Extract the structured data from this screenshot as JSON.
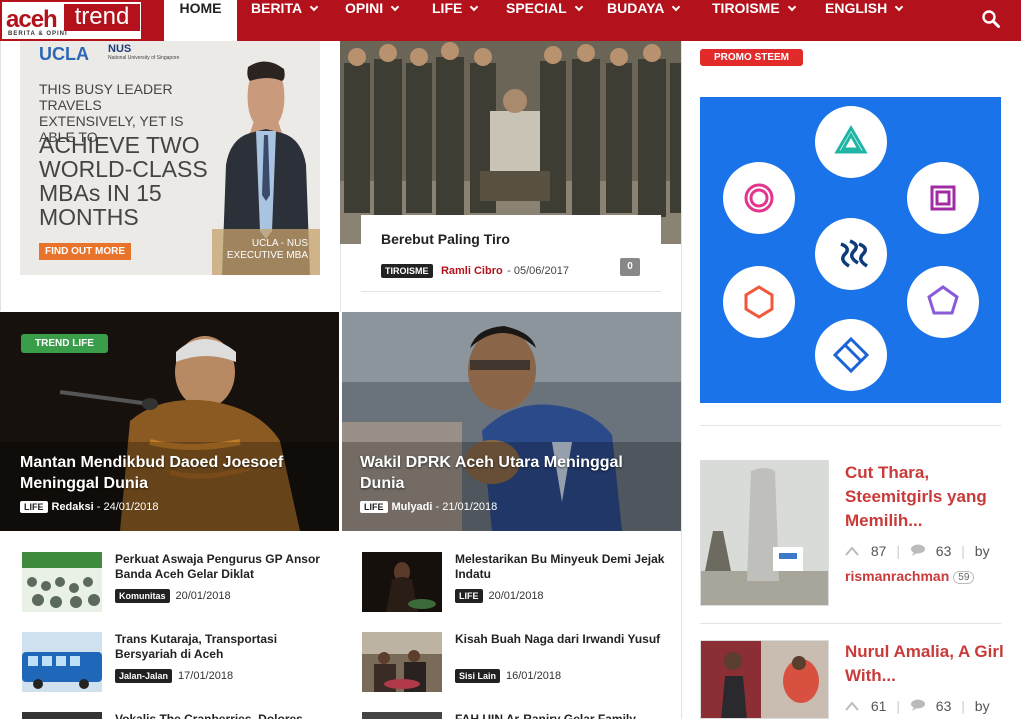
{
  "logo": {
    "word1": "aceh",
    "word2": "trend",
    "tagline": "BERITA & OPINI"
  },
  "nav": {
    "items": [
      {
        "label": "HOME"
      },
      {
        "label": "BERITA"
      },
      {
        "label": "OPINI"
      },
      {
        "label": "LIFE"
      },
      {
        "label": "SPECIAL"
      },
      {
        "label": "BUDAYA"
      },
      {
        "label": "TIROISME"
      },
      {
        "label": "ENGLISH"
      }
    ]
  },
  "ad": {
    "brand1": "UCLA",
    "brand2": "NUS",
    "brand2_sub": "National University of Singapore",
    "line1": "THIS BUSY LEADER TRAVELS EXTENSIVELY, YET IS ABLE TO",
    "line2": "ACHIEVE TWO WORLD-CLASS MBAs IN 15 MONTHS",
    "cta": "FIND OUT MORE",
    "program": "UCLA - NUS EXECUTIVE MBA"
  },
  "featured": {
    "title": "Berebut Paling Tiro",
    "category": "TIROISME",
    "author": "Ramli Cibro",
    "date": "05/06/2017",
    "comments": "0"
  },
  "tiles": [
    {
      "badge": "TREND LIFE",
      "title": "Mantan Mendikbud Daoed Joesoef Meninggal Dunia",
      "category": "LIFE",
      "author": "Redaksi",
      "date": "24/01/2018"
    },
    {
      "title": "Wakil DPRK Aceh Utara Meninggal Dunia",
      "category": "LIFE",
      "author": "Mulyadi",
      "date": "21/01/2018"
    }
  ],
  "list": {
    "left": [
      {
        "title": "Perkuat Aswaja Pengurus GP Ansor Banda Aceh Gelar Diklat",
        "category": "Komunitas",
        "date": "20/01/2018"
      },
      {
        "title": "Trans Kutaraja, Transportasi Bersyariah di Aceh",
        "category": "Jalan-Jalan",
        "date": "17/01/2018"
      },
      {
        "title": "Vokalis The Cranberries, Dolores"
      }
    ],
    "right": [
      {
        "title": "Melestarikan Bu Minyeuk Demi Jejak Indatu",
        "category": "LIFE",
        "date": "20/01/2018"
      },
      {
        "title": "Kisah Buah Naga dari Irwandi Yusuf",
        "category": "Sisi Lain",
        "date": "16/01/2018"
      },
      {
        "title": "FAH UIN Ar-Raniry Gelar Family"
      }
    ]
  },
  "sidebar": {
    "promo_label": "PROMO STEEM",
    "posts": [
      {
        "title": "Cut Thara, Steemitgirls yang Memilih...",
        "votes": "87",
        "comments": "63",
        "by": "by",
        "user": "rismanrachman",
        "rep": "59"
      },
      {
        "title": "Nurul Amalia, A Girl With...",
        "votes": "61",
        "comments": "63",
        "by": "by"
      }
    ]
  },
  "colors": {
    "brand": "#b3121c",
    "trend_life": "#3a9d4a",
    "promo": "#e12b2b",
    "steem_bg": "#1a73e8",
    "sidebar_title": "#c93a3a"
  }
}
